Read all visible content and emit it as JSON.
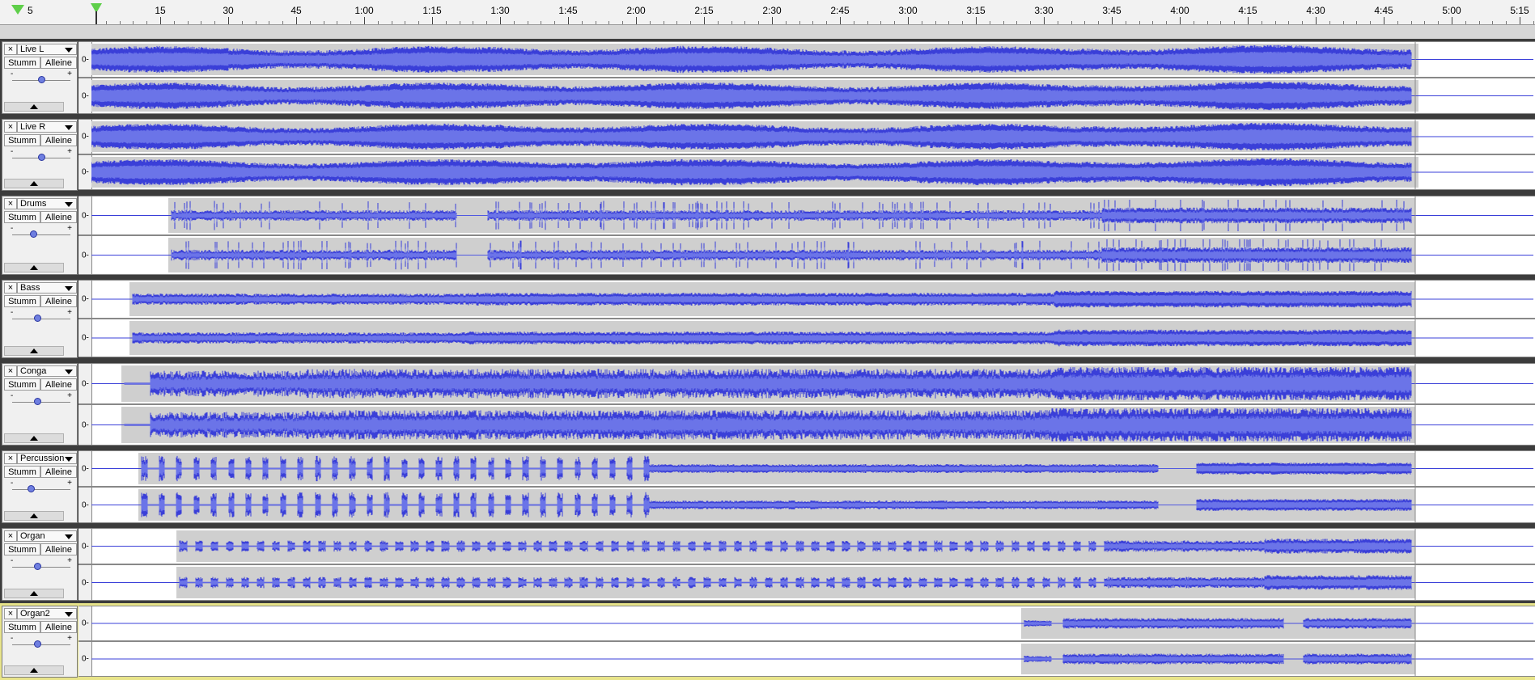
{
  "ruler": {
    "first_label": "5",
    "labels": [
      "15",
      "30",
      "45",
      "1:00",
      "1:15",
      "1:30",
      "1:45",
      "2:00",
      "2:15",
      "2:30",
      "2:45",
      "3:00",
      "3:15",
      "3:30",
      "3:45",
      "4:00",
      "4:15",
      "4:30",
      "4:45",
      "5:00",
      "5:15"
    ]
  },
  "track_controls": {
    "close_glyph": "×",
    "mute_label": "Stumm",
    "solo_label": "Alleine",
    "gain_minus": "-",
    "gain_plus": "+",
    "channel_zero": "0-"
  },
  "colors": {
    "waveform": "#3a3fd8",
    "waveform_rms": "#6b74e8",
    "envelope_bg": "#cfcfcf",
    "selected_track_border": "#e8e48a"
  },
  "tracks": [
    {
      "name": "Live L",
      "gain_level": 0.5,
      "selected": false,
      "start": 0.0,
      "end": 4.77,
      "style": "dense"
    },
    {
      "name": "Live R",
      "gain_level": 0.5,
      "selected": false,
      "start": 0.0,
      "end": 4.77,
      "style": "dense"
    },
    {
      "name": "Drums",
      "gain_level": 0.35,
      "selected": false,
      "start": 0.29,
      "end": 4.77,
      "style": "drums"
    },
    {
      "name": "Bass",
      "gain_level": 0.42,
      "selected": false,
      "start": 0.15,
      "end": 4.77,
      "style": "bass"
    },
    {
      "name": "Conga",
      "gain_level": 0.42,
      "selected": false,
      "start": 0.12,
      "end": 4.77,
      "style": "conga"
    },
    {
      "name": "Percussion",
      "gain_level": 0.3,
      "selected": false,
      "start": 0.18,
      "end": 4.77,
      "style": "perc"
    },
    {
      "name": "Organ",
      "gain_level": 0.42,
      "selected": false,
      "start": 0.32,
      "end": 4.77,
      "style": "organ"
    },
    {
      "name": "Organ2",
      "gain_level": 0.42,
      "selected": true,
      "start": 3.37,
      "end": 4.77,
      "style": "organ2"
    }
  ]
}
